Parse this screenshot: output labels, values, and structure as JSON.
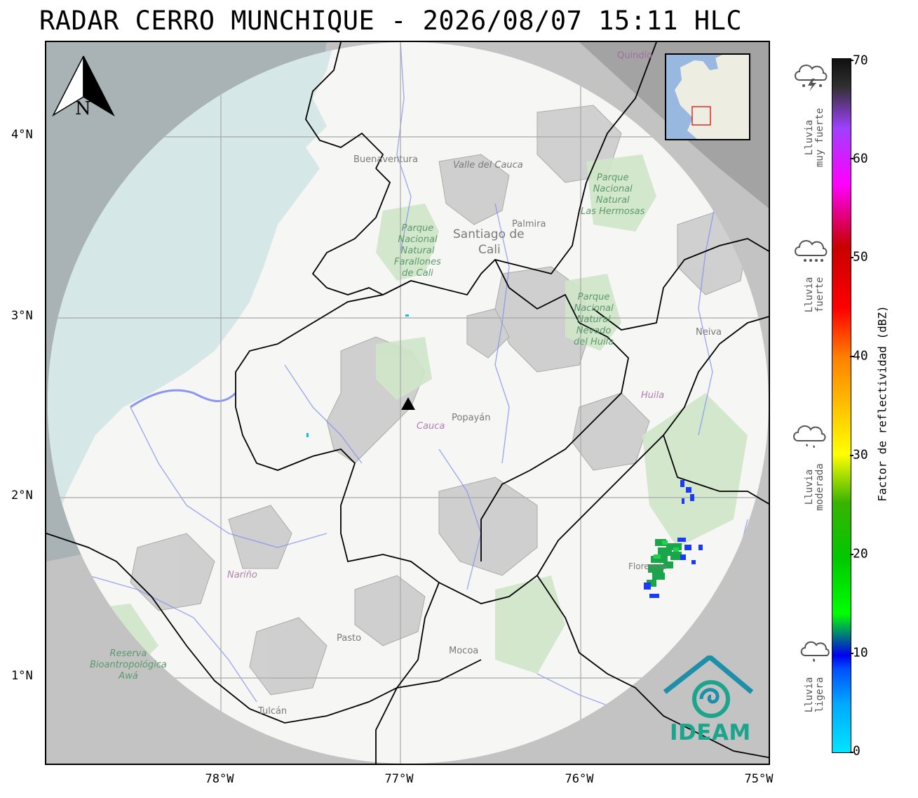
{
  "title": "RADAR CERRO MUNCHIQUE - 2026/08/07 15:11 HLC",
  "lat_ticks": [
    "4°N",
    "3°N",
    "2°N",
    "1°N"
  ],
  "lon_ticks": [
    "78°W",
    "77°W",
    "76°W",
    "75°W"
  ],
  "colorbar": {
    "label": "Factor de reflectividad (dBZ)",
    "ticks": [
      "70",
      "60",
      "50",
      "40",
      "30",
      "20",
      "10",
      "0"
    ]
  },
  "rain_categories": [
    {
      "line1": "Lluvia",
      "line2": "muy fuerte",
      "icon": "thunderstorm-cloud-icon"
    },
    {
      "line1": "Lluvia",
      "line2": "fuerte",
      "icon": "heavy-rain-cloud-icon"
    },
    {
      "line1": "Lluvia",
      "line2": "moderada",
      "icon": "moderate-rain-cloud-icon"
    },
    {
      "line1": "Lluvia",
      "line2": "ligera",
      "icon": "light-rain-cloud-icon"
    }
  ],
  "compass_letter": "N",
  "logo_text": "IDEAM",
  "places": {
    "buenaventura": "Buenaventura",
    "valle": "Valle del Cauca",
    "palmira": "Palmira",
    "cali1": "Santiago de",
    "cali2": "Cali",
    "neiva": "Neiva",
    "huila": "Huila",
    "cauca": "Cauca",
    "popayan": "Popayán",
    "narino": "Nariño",
    "pasto": "Pasto",
    "mocoa": "Mocoa",
    "tulcan": "Tulcán",
    "quindio": "Quindío",
    "florencia": "Florencia"
  },
  "parks": {
    "farallones": [
      "Parque",
      "Nacional",
      "Natural",
      "Farallones",
      "de Cali"
    ],
    "hermosas": [
      "Parque",
      "Nacional",
      "Natural",
      "Las Hermosas"
    ],
    "nevado": [
      "Parque",
      "Nacional",
      "Natural",
      "Nevado",
      "del Huila"
    ],
    "awa": [
      "Reserva",
      "Bioantropológica",
      "Awá"
    ]
  },
  "radar_site": {
    "lon": -77.0,
    "lat": 2.5
  },
  "colors": {
    "coverage_disk": "#f5f5f3",
    "outside": "#c4c4c4",
    "ocean": "#d5e6e6",
    "rivers": "#7a8cf0",
    "boundaries": "#000000",
    "logo": "#1aa58c"
  }
}
